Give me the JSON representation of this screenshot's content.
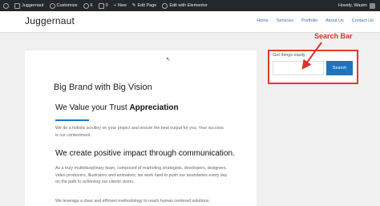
{
  "adminbar": {
    "site_name": "Juggernaut",
    "customize": "Customize",
    "updates": "6",
    "comments": "0",
    "new": "New",
    "edit_page": "Edit Page",
    "edit_elementor": "Edit with Elementor",
    "howdy": "Howdy, Wasim"
  },
  "header": {
    "site_title": "Juggernaut",
    "nav": [
      "Home",
      "Services",
      "Portfolio",
      "About Us",
      "Contact Us"
    ]
  },
  "content": {
    "main_heading": "Big Brand with Big Vision",
    "h2_plain": "We Value your Trust ",
    "h2_bold": "Appreciation",
    "p1": "We do a holistic scrutiny on your project and ensure the best output for you. Your success is our contentment.",
    "h3": "We create positive impact through communication.",
    "p2": "As a truly multidisciplinary team, composed of marketing strategists, developers, designers, video producers, illustrators and animators, we work hard to push our boundaries every day on the path to achieving our clients vision.",
    "p3": "We leverage a clear and efficient methodology to reach human centered solutions."
  },
  "sidebar": {
    "search_label": "Get things easily",
    "search_placeholder": "",
    "search_button": "Search"
  },
  "annotation": {
    "label": "Search Bar",
    "color": "#e53a2f"
  },
  "colors": {
    "accent": "#1e73be",
    "adminbar": "#23282d"
  }
}
